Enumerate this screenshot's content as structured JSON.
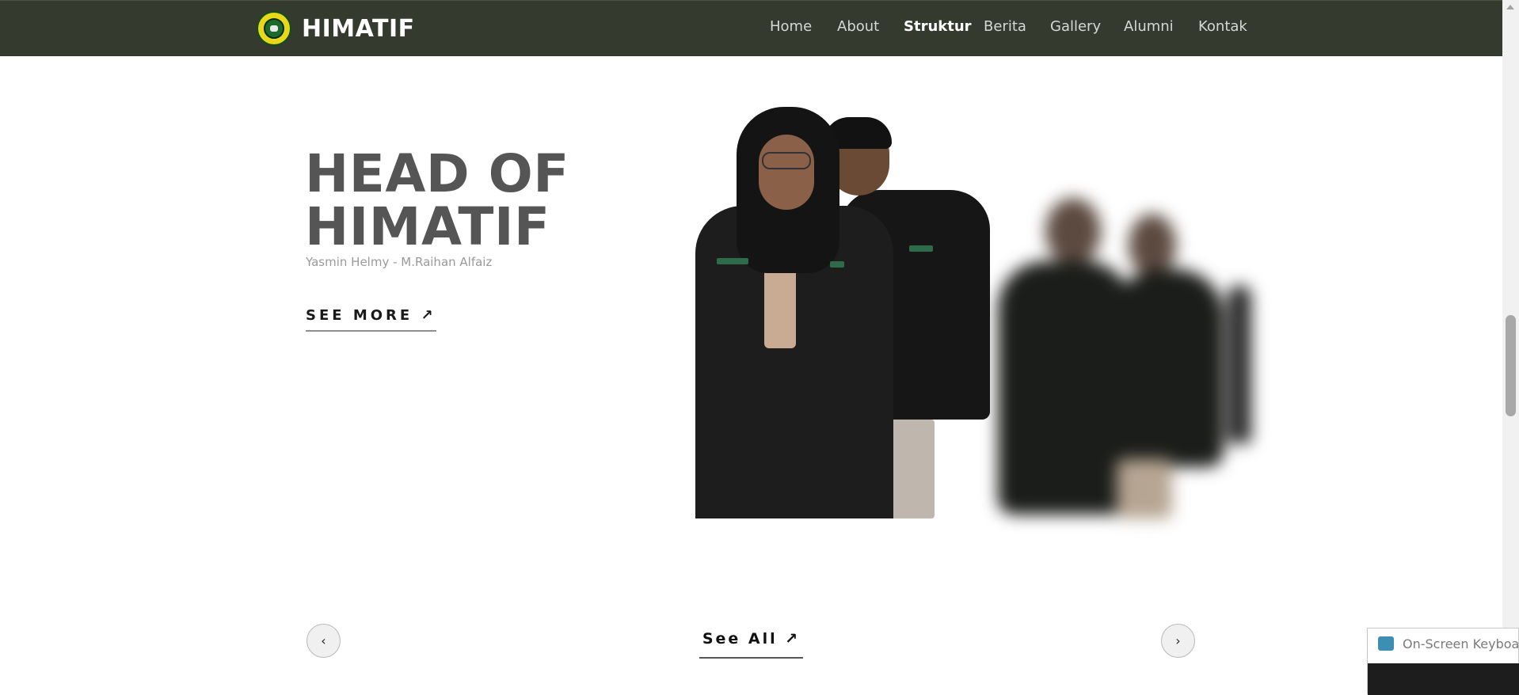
{
  "navbar": {
    "brand": "HIMATIF",
    "links": [
      {
        "label": "Home",
        "active": false
      },
      {
        "label": "About",
        "active": false
      },
      {
        "label": "Struktur",
        "active": true
      },
      {
        "label": "Berita",
        "active": false
      },
      {
        "label": "Gallery",
        "active": false
      },
      {
        "label": "Alumni",
        "active": false
      },
      {
        "label": "Kontak",
        "active": false
      }
    ]
  },
  "hero": {
    "title": "HEAD OF HIMATIF",
    "subtitle": "Yasmin Helmy - M.Raihan Alfaiz",
    "see_more": "SEE MORE ↗"
  },
  "controls": {
    "prev_icon": "‹",
    "next_icon": "›",
    "see_all": "See All ↗"
  },
  "osk": {
    "title": "On-Screen Keyboard"
  },
  "colors": {
    "navbar_bg": "#343b2e",
    "title": "#555555",
    "logo_yellow": "#e8d81a",
    "logo_green": "#1c6b2a"
  }
}
